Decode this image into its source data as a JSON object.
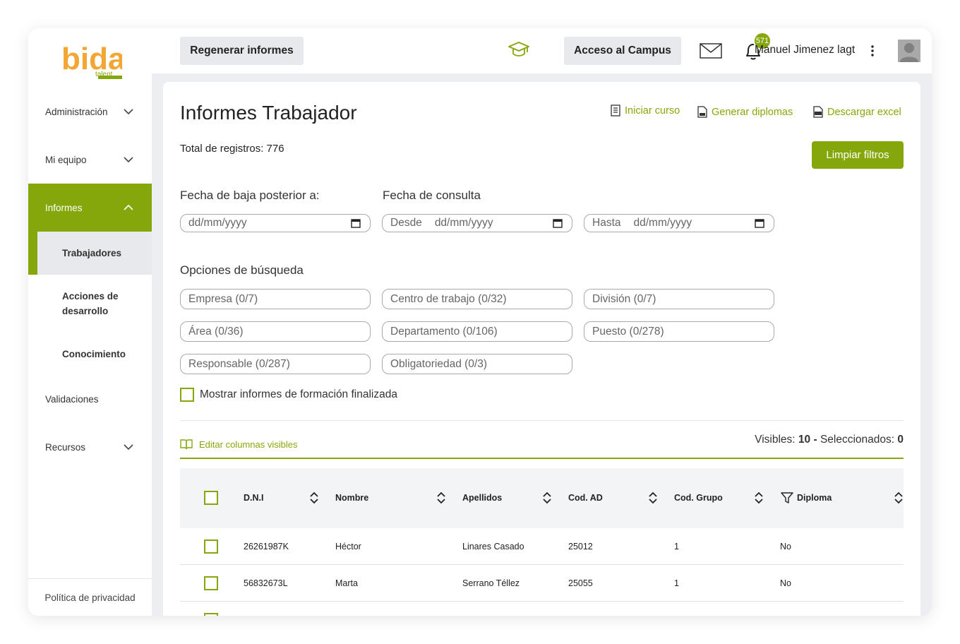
{
  "colors": {
    "brand": "#86a70b",
    "button_gray": "#e8e9ec",
    "app_background": "#eceef1"
  },
  "logo": {
    "text": "bida",
    "subtext": "talent"
  },
  "sidebar": {
    "items": [
      {
        "label": "Administración",
        "icon": "chevron-down-icon"
      },
      {
        "label": "Mi equipo",
        "icon": "chevron-down-icon"
      },
      {
        "label": "Informes",
        "icon": "chevron-up-icon",
        "active": true
      },
      {
        "label": "Validaciones"
      },
      {
        "label": "Recursos",
        "icon": "chevron-down-icon"
      }
    ],
    "subitems": [
      {
        "label": "Trabajadores",
        "selected": true
      },
      {
        "label": "Acciones de desarrollo"
      },
      {
        "label": "Conocimiento"
      }
    ],
    "privacy": "Política de privacidad"
  },
  "header": {
    "regenerate": "Regenerar informes",
    "campus_icon": "graduation-cap-icon",
    "campus": "Acceso al Campus",
    "mail_icon": "envelope-icon",
    "bell_icon": "bell-icon",
    "notifications": "571",
    "user": "Manuel Jimenez lagt"
  },
  "page": {
    "title": "Informes Trabajador",
    "actions": {
      "start": "Iniciar curso",
      "diplomas": "Generar diplomas",
      "excel": "Descargar excel"
    },
    "total": "Total de registros: 776",
    "clear": "Limpiar filtros",
    "filters": {
      "baja_label": "Fecha de baja posterior a:",
      "consulta_label": "Fecha de consulta",
      "date_placeholder": "dd/mm/yyyy",
      "desde": "Desde",
      "hasta": "Hasta"
    },
    "search": {
      "label": "Opciones de búsqueda",
      "empresa": "Empresa (0/7)",
      "centro": "Centro de trabajo (0/32)",
      "division": "División (0/7)",
      "area": "Área (0/36)",
      "departamento": "Departamento (0/106)",
      "puesto": "Puesto (0/278)",
      "responsable": "Responsable (0/287)",
      "obligatoriedad": "Obligatoriedad (0/3)"
    },
    "show_finished": "Mostrar informes de formación finalizada",
    "edit_columns": "Editar columnas visibles",
    "visibles_label": "Visibles:",
    "visibles_value": "10",
    "separator": "-",
    "selected_label": "Seleccionados:",
    "selected_value": "0"
  },
  "table": {
    "columns": [
      "D.N.I",
      "Nombre",
      "Apellidos",
      "Cod. AD",
      "Cod. Grupo",
      "Diploma"
    ],
    "rows": [
      {
        "dni": "26261987K",
        "nombre": "Héctor",
        "apellidos": "Linares Casado",
        "cod_ad": "25012",
        "cod_grupo": "1",
        "diploma": "No"
      },
      {
        "dni": "56832673L",
        "nombre": "Marta",
        "apellidos": "Serrano Téllez",
        "cod_ad": "25055",
        "cod_grupo": "1",
        "diploma": "No"
      }
    ]
  }
}
